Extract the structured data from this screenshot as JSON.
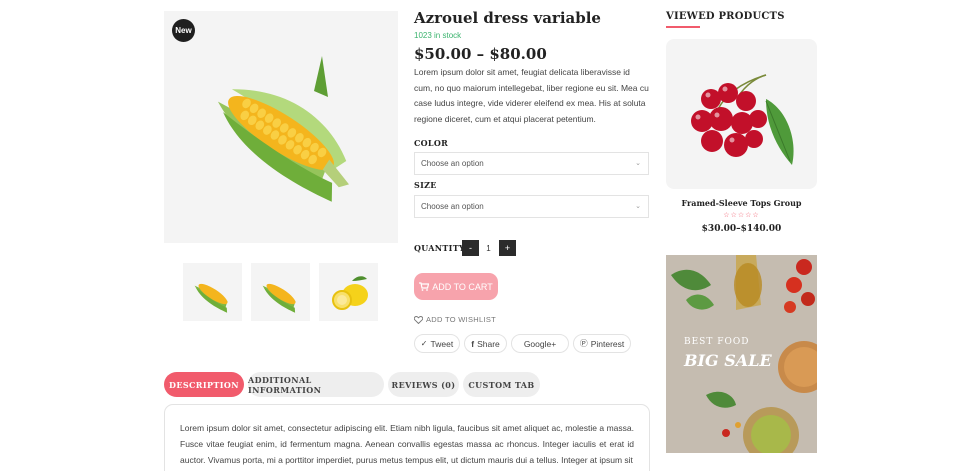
{
  "gallery": {
    "badge": "New",
    "main_image": "corn-image",
    "thumbnails": [
      "corn-thumbnail",
      "corn-thumbnail",
      "lemon-thumbnail"
    ]
  },
  "product": {
    "title": "Azrouel dress variable",
    "stock": "1023 in stock",
    "price": "$50.00 – $80.00",
    "description": "Lorem ipsum dolor sit amet, feugiat delicata liberavisse id cum, no quo maiorum intellegebat, liber regione eu sit. Mea cu case ludus integre, vide viderer eleifend ex mea. His at soluta regione diceret, cum et atqui placerat petentium.",
    "color_label": "COLOR",
    "color_placeholder": "Choose an option",
    "size_label": "SIZE",
    "size_placeholder": "Choose an option",
    "quantity_label": "QUANTITY:",
    "quantity_minus": "-",
    "quantity_value": "1",
    "quantity_plus": "+",
    "add_to_cart": "ADD TO CART",
    "wishlist": "ADD TO WISHLIST",
    "share": {
      "tweet": "Tweet",
      "facebook": "Share",
      "google": "Google+",
      "pinterest": "Pinterest"
    }
  },
  "tabs": [
    {
      "label": "DESCRIPTION",
      "active": true
    },
    {
      "label": "ADDITIONAL INFORMATION",
      "active": false
    },
    {
      "label": "REVIEWS (0)",
      "active": false
    },
    {
      "label": "CUSTOM TAB",
      "active": false
    }
  ],
  "tab_content": "Lorem ipsum dolor sit amet, consectetur adipiscing elit. Etiam nibh ligula, faucibus sit amet aliquet ac, molestie a massa. Fusce vitae feugiat enim, id fermentum magna. Aenean convallis egestas massa ac rhoncus. Integer iaculis et erat id auctor. Vivamus porta, mi a porttitor imperdiet, purus metus tempus elit, ut dictum mauris dui a tellus. Integer at ipsum sit",
  "sidebar": {
    "title": "VIEWED PRODUCTS",
    "product_name": "Framed-Sleeve Tops Group",
    "product_stars": "☆☆☆☆☆",
    "product_price": "$30.00–$140.00",
    "banner_subtitle": "BEST FOOD",
    "banner_title": "BIG SALE"
  },
  "colors": {
    "accent": "#f15b6c",
    "add_to_cart_bg": "#f7a3ac",
    "stock_green": "#3ab36d",
    "dark_button": "#2b2b2b"
  }
}
